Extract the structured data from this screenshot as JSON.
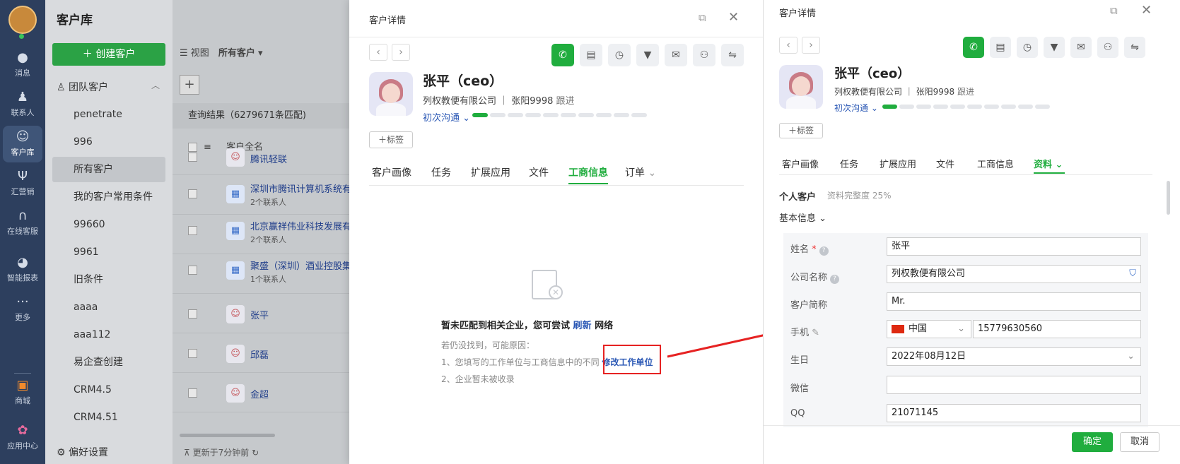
{
  "nav": {
    "items": [
      {
        "icon": "message-icon",
        "label": "消息"
      },
      {
        "icon": "contacts-icon",
        "label": "联系人"
      },
      {
        "icon": "customer-icon",
        "label": "客户库"
      },
      {
        "icon": "marketing-icon",
        "label": "汇营销"
      },
      {
        "icon": "headset-icon",
        "label": "在线客服"
      },
      {
        "icon": "pie-chart-icon",
        "label": "智能报表"
      },
      {
        "icon": "more-icon",
        "label": "更多"
      },
      {
        "icon": "store-icon",
        "label": "商城"
      },
      {
        "icon": "apps-icon",
        "label": "应用中心"
      }
    ]
  },
  "sidebar": {
    "title": "客户库",
    "create_label": "创建客户",
    "group_label": "团队客户",
    "items": [
      "penetrate",
      "996",
      "所有客户",
      "我的客户常用条件",
      "99660",
      "9961",
      "旧条件",
      "aaaa",
      "aaa112",
      "易企查创建",
      "CRM4.5",
      "CRM4.51"
    ],
    "footer_label": "偏好设置"
  },
  "list": {
    "view_label": "视图",
    "view_value": "所有客户",
    "result_text": "查询结果（6279671条匹配)",
    "column_header": "客户全名",
    "rows": [
      {
        "name": "腾讯轻联",
        "sub": "",
        "type": "person"
      },
      {
        "name": "深圳市腾讯计算机系统有",
        "sub": "2个联系人",
        "type": "company"
      },
      {
        "name": "北京赢祥伟业科技发展有",
        "sub": "2个联系人",
        "type": "company"
      },
      {
        "name": "聚盛（深圳）酒业控股集",
        "sub": "1个联系人",
        "type": "company"
      },
      {
        "name": "张平",
        "sub": "",
        "type": "person"
      },
      {
        "name": "邱磊",
        "sub": "",
        "type": "person"
      },
      {
        "name": "金超",
        "sub": "",
        "type": "person"
      }
    ],
    "footer_text": "更新于7分钟前"
  },
  "detail": {
    "panel_title": "客户详情",
    "customer_name": "张平（ceo）",
    "company": "列权教便有限公司",
    "owner": "张阳9998",
    "follow_label": "跟进",
    "stage": "初次沟通",
    "progress_fraction": 0.1,
    "tag_label": "标签",
    "tabs": [
      "客户画像",
      "任务",
      "扩展应用",
      "文件",
      "工商信息",
      "订单"
    ],
    "active_tab": "工商信息",
    "empty_message": "暂未匹配到相关企业，您可尝试",
    "empty_refresh": "刷新",
    "empty_network": "网络",
    "hint_title": "若仍没找到，可能原因：",
    "hint_1": "1、您填写的工作单位与工商信息中的不同",
    "hint_1_link": "修改工作单位",
    "hint_2": "2、企业暂未被收录"
  },
  "right_panel": {
    "panel_title": "客户详情",
    "customer_name": "张平（ceo）",
    "company": "列权教便有限公司",
    "owner": "张阳9998",
    "follow_label": "跟进",
    "stage": "初次沟通",
    "tag_label": "标签",
    "tabs": [
      "客户画像",
      "任务",
      "扩展应用",
      "文件",
      "工商信息",
      "资料"
    ],
    "active_tab": "资料",
    "profile_type": "个人客户",
    "completeness": "资料完整度 25%",
    "section_label": "基本信息",
    "fields": {
      "name_label": "姓名",
      "name_value": "张平",
      "company_label": "公司名称",
      "company_value": "列权教便有限公司",
      "short_label": "客户简称",
      "short_value": "Mr.",
      "phone_label": "手机",
      "country": "中国",
      "phone_value": "15779630560",
      "birthday_label": "生日",
      "birthday_value": "2022年08月12日",
      "wechat_label": "微信",
      "wechat_value": "",
      "qq_label": "QQ",
      "qq_value": "21071145"
    },
    "confirm_label": "确定",
    "cancel_label": "取消"
  },
  "colors": {
    "accent": "#20ad3e",
    "link": "#2b58b5",
    "highlight": "#e62222"
  }
}
